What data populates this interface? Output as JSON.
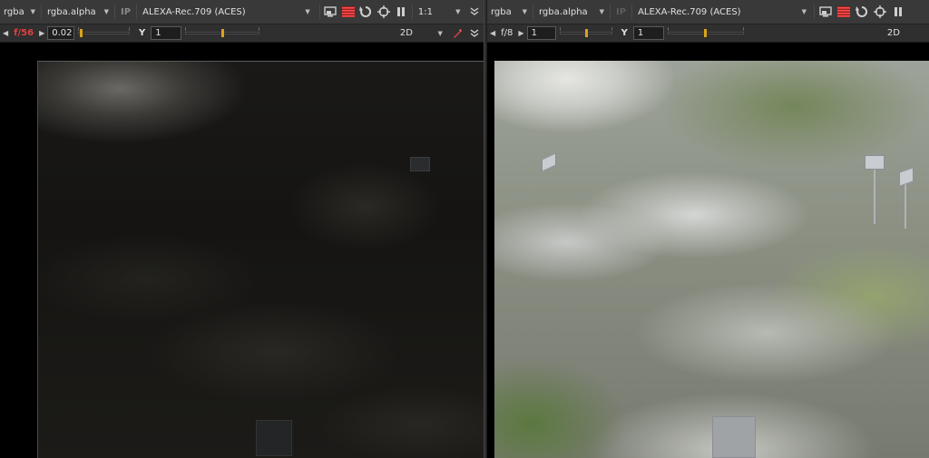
{
  "left_viewer": {
    "channels": "rgba",
    "alpha_channel": "rgba.alpha",
    "ip_label": "IP",
    "lut": "ALEXA-Rec.709 (ACES)",
    "zoom": "1:1",
    "fstop": "f/56",
    "gain": "0.02",
    "gamma_label": "Y",
    "gamma": "1",
    "view_mode": "2D"
  },
  "right_viewer": {
    "channels": "rgba",
    "alpha_channel": "rgba.alpha",
    "ip_label": "IP",
    "lut": "ALEXA-Rec.709 (ACES)",
    "fstop": "f/8",
    "gain": "1",
    "gamma_label": "Y",
    "gamma": "1",
    "view_mode": "2D"
  },
  "colors": {
    "toolbar_bg": "#393939",
    "secondary_bar_bg": "#2f2f2f",
    "accent_red": "#e04040",
    "slider_handle": "#d9a31b"
  },
  "icons": [
    "monitor-icon",
    "stripes-icon",
    "refresh-icon",
    "crosshair-icon",
    "pause-icon",
    "chevron-down-icon",
    "pen-icon",
    "double-chevron-icon"
  ]
}
